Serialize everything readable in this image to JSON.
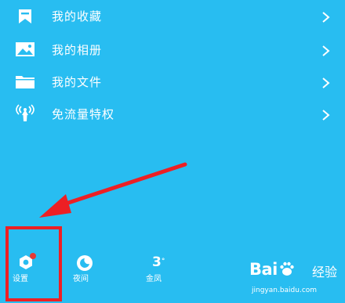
{
  "menu": {
    "items": [
      {
        "label": "我的收藏",
        "icon": "bookmark-icon"
      },
      {
        "label": "我的相册",
        "icon": "photo-album-icon"
      },
      {
        "label": "我的文件",
        "icon": "folder-icon"
      },
      {
        "label": "免流量特权",
        "icon": "antenna-icon"
      }
    ]
  },
  "toolbar": {
    "settings_label": "设置",
    "night_label": "夜间",
    "weather_temp": "3",
    "weather_degree": "°",
    "weather_label": "金凤"
  },
  "watermark": {
    "brand": "Bai",
    "brand_tail": "经验",
    "url": "jingyan.baidu.com"
  },
  "colors": {
    "background": "#28bdf1",
    "highlight": "#ed1f24",
    "notification_dot": "#e53935"
  }
}
